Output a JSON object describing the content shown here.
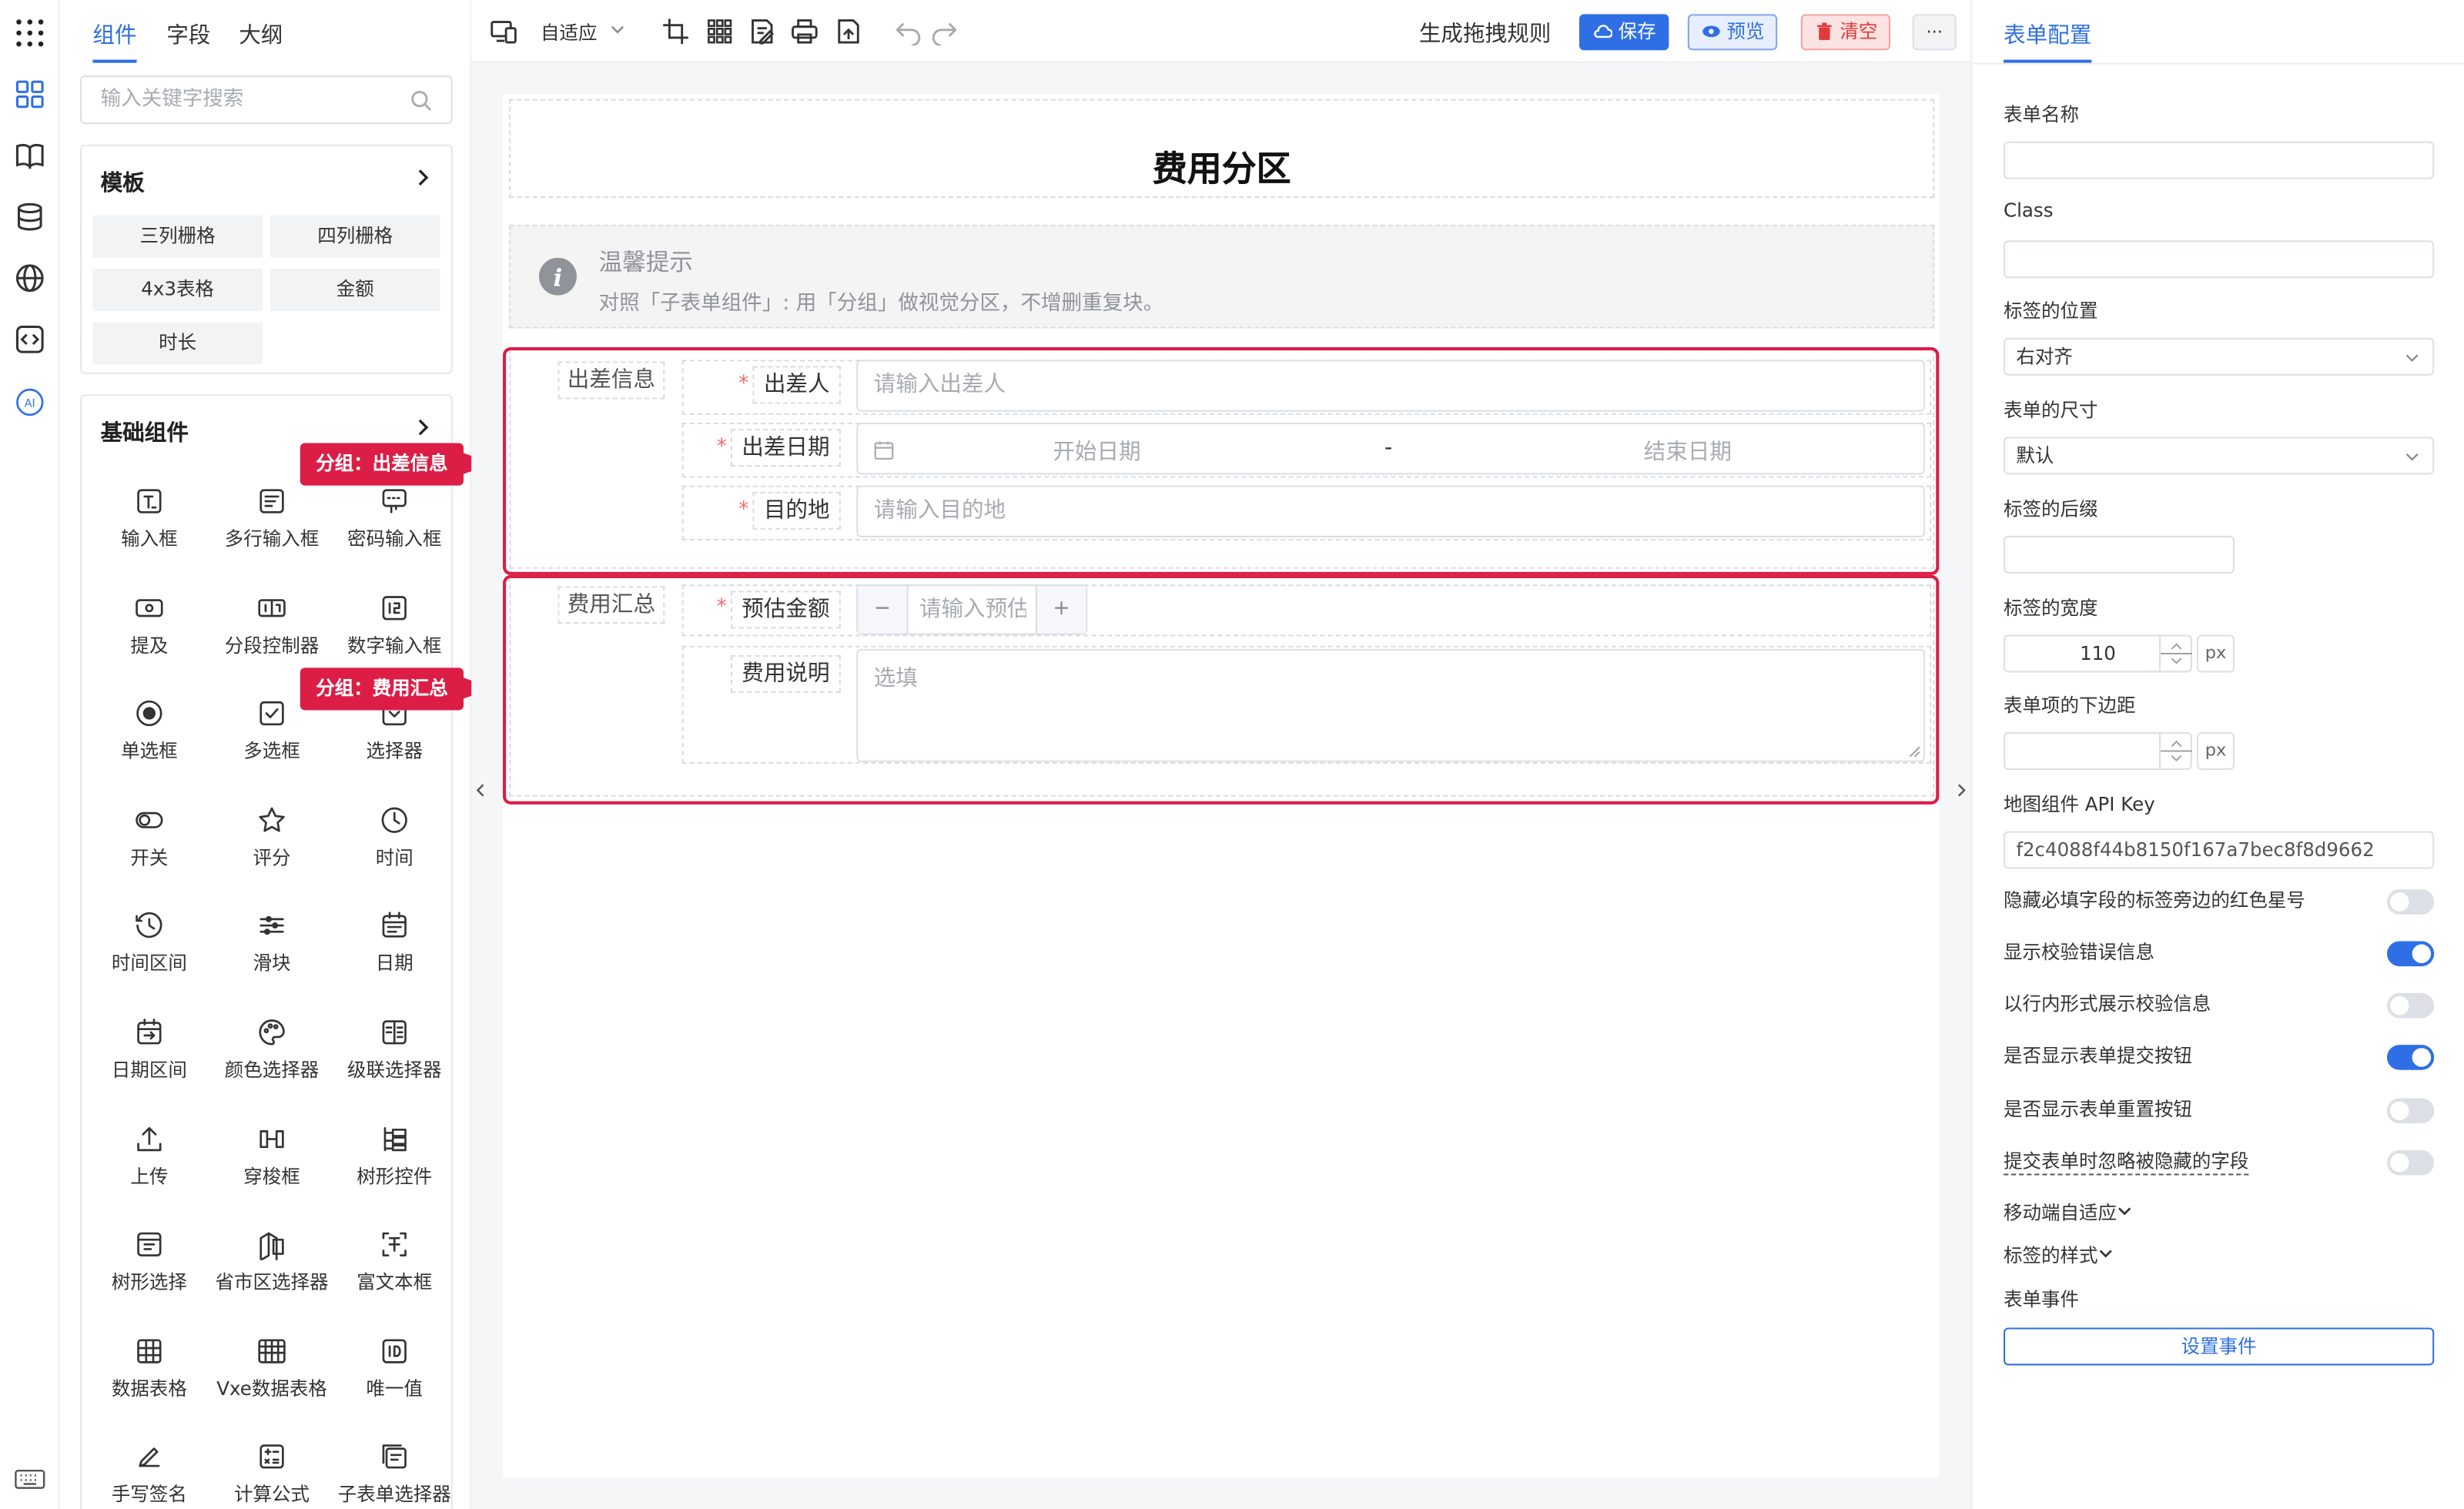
{
  "left_panel": {
    "tabs": [
      "组件",
      "字段",
      "大纲"
    ],
    "search_placeholder": "输入关键字搜索",
    "templates": {
      "title": "模板",
      "items": [
        "三列栅格",
        "四列栅格",
        "4x3表格",
        "金额",
        "时长"
      ]
    },
    "basic": {
      "title": "基础组件",
      "items": [
        {
          "label": "输入框",
          "icon": "text-input-icon"
        },
        {
          "label": "多行输入框",
          "icon": "textarea-icon"
        },
        {
          "label": "密码输入框",
          "icon": "password-input-icon"
        },
        {
          "label": "提及",
          "icon": "mention-icon"
        },
        {
          "label": "分段控制器",
          "icon": "segmented-icon"
        },
        {
          "label": "数字输入框",
          "icon": "number-input-icon"
        },
        {
          "label": "单选框",
          "icon": "radio-icon"
        },
        {
          "label": "多选框",
          "icon": "checkbox-icon"
        },
        {
          "label": "选择器",
          "icon": "select-icon"
        },
        {
          "label": "开关",
          "icon": "switch-icon"
        },
        {
          "label": "评分",
          "icon": "star-icon"
        },
        {
          "label": "时间",
          "icon": "clock-icon"
        },
        {
          "label": "时间区间",
          "icon": "time-range-icon"
        },
        {
          "label": "滑块",
          "icon": "slider-icon"
        },
        {
          "label": "日期",
          "icon": "calendar-icon"
        },
        {
          "label": "日期区间",
          "icon": "date-range-icon"
        },
        {
          "label": "颜色选择器",
          "icon": "palette-icon"
        },
        {
          "label": "级联选择器",
          "icon": "cascader-icon"
        },
        {
          "label": "上传",
          "icon": "upload-icon"
        },
        {
          "label": "穿梭框",
          "icon": "transfer-icon"
        },
        {
          "label": "树形控件",
          "icon": "tree-icon"
        },
        {
          "label": "树形选择",
          "icon": "tree-select-icon"
        },
        {
          "label": "省市区选择器",
          "icon": "region-select-icon"
        },
        {
          "label": "富文本框",
          "icon": "rich-text-icon"
        },
        {
          "label": "数据表格",
          "icon": "table-icon"
        },
        {
          "label": "Vxe数据表格",
          "icon": "vxe-table-icon"
        },
        {
          "label": "唯一值",
          "icon": "id-icon"
        },
        {
          "label": "手写签名",
          "icon": "signature-icon"
        },
        {
          "label": "计算公式",
          "icon": "calculator-icon"
        },
        {
          "label": "子表单选择器",
          "icon": "subform-select-icon"
        }
      ]
    },
    "callouts": [
      "分组：出差信息",
      "分组：费用汇总"
    ]
  },
  "toolbar": {
    "adapt_label": "自适应",
    "rule_label": "生成拖拽规则",
    "save_label": "保存",
    "preview_label": "预览",
    "clear_label": "清空",
    "more_label": "···"
  },
  "form": {
    "title": "费用分区",
    "tip": {
      "title": "温馨提示",
      "text": "对照「子表单组件」: 用「分组」做视觉分区，不增删重复块。"
    },
    "group1": {
      "title": "出差信息",
      "traveler_label": "出差人",
      "traveler_placeholder": "请输入出差人",
      "date_label": "出差日期",
      "date_start_placeholder": "开始日期",
      "date_sep": "-",
      "date_end_placeholder": "结束日期",
      "dest_label": "目的地",
      "dest_placeholder": "请输入目的地"
    },
    "group2": {
      "title": "费用汇总",
      "amount_label": "预估金额",
      "amount_placeholder": "请输入预估",
      "minus": "−",
      "plus": "+",
      "desc_label": "费用说明",
      "desc_placeholder": "选填"
    }
  },
  "config": {
    "tab": "表单配置",
    "form_name_label": "表单名称",
    "form_name_value": "",
    "class_label": "Class",
    "class_value": "",
    "label_position_label": "标签的位置",
    "label_position_value": "右对齐",
    "form_size_label": "表单的尺寸",
    "form_size_value": "默认",
    "label_suffix_label": "标签的后缀",
    "label_suffix_value": "",
    "label_width_label": "标签的宽度",
    "label_width_value": "110",
    "label_width_unit": "px",
    "item_margin_label": "表单项的下边距",
    "item_margin_value": "",
    "item_margin_unit": "px",
    "map_key_label": "地图组件 API Key",
    "map_key_value": "f2c4088f44b8150f167a7bec8f8d9662",
    "switches": [
      {
        "label": "隐藏必填字段的标签旁边的红色星号",
        "on": false
      },
      {
        "label": "显示校验错误信息",
        "on": true
      },
      {
        "label": "以行内形式展示校验信息",
        "on": false
      },
      {
        "label": "是否显示表单提交按钮",
        "on": true
      },
      {
        "label": "是否显示表单重置按钮",
        "on": false
      },
      {
        "label": "提交表单时忽略被隐藏的字段",
        "on": false
      }
    ],
    "mobile_label": "移动端自适应",
    "label_style_label": "标签的样式",
    "events_label": "表单事件",
    "set_event_button": "设置事件"
  },
  "colors": {
    "accent": "#2f6fe5",
    "callout_red": "#dc1d45",
    "save_bg": "#2f6fe5",
    "preview_bg": "#e8effc",
    "clear_bg": "#fde2e2"
  }
}
